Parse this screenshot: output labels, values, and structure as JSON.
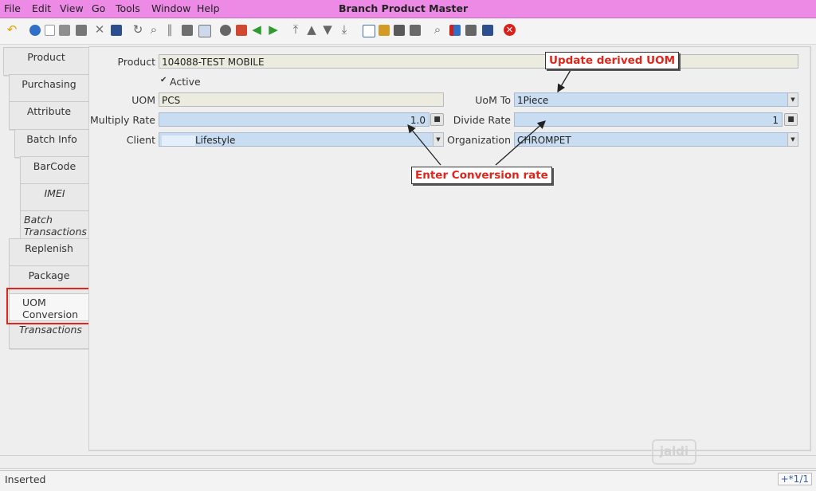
{
  "menu": {
    "file": "File",
    "edit": "Edit",
    "view": "View",
    "go": "Go",
    "tools": "Tools",
    "window": "Window",
    "help": "Help"
  },
  "window_title": "Branch Product Master",
  "tabs": [
    {
      "label": "Product"
    },
    {
      "label": "Purchasing"
    },
    {
      "label": "Attribute"
    },
    {
      "label": "Batch Info"
    },
    {
      "label": "BarCode"
    },
    {
      "label": "IMEI"
    },
    {
      "label": "Batch Transactions"
    },
    {
      "label": "Replenish"
    },
    {
      "label": "Package"
    },
    {
      "label": "UOM Conversion"
    },
    {
      "label": "Transactions"
    }
  ],
  "form": {
    "product_label": "Product",
    "product_value": "104088-TEST MOBILE",
    "active_label": "Active",
    "active_check": "✔",
    "uom_label": "UOM",
    "uom_value": "PCS",
    "uomto_label": "UoM To",
    "uomto_value": "1Piece",
    "multiply_label": "Multiply Rate",
    "multiply_value": "1.0",
    "divide_label": "Divide Rate",
    "divide_value": "1",
    "client_label": "Client",
    "client_value": "Lifestyle",
    "org_label": "Organization",
    "org_value": "CHROMPET"
  },
  "annotations": {
    "update_uom": "Update derived UOM",
    "enter_rate": "Enter Conversion rate"
  },
  "watermark": "jaldi",
  "status": {
    "text": "Inserted",
    "record": "+*1/1"
  },
  "colors": {
    "menubar": "#ec8ae6",
    "field_edit": "#c9ddf2",
    "field_readonly": "#ebebdf",
    "annotation": "#e0261c"
  },
  "toolbar_icons": [
    "undo-icon",
    "help-icon",
    "new-icon",
    "copy-icon",
    "delete-icon",
    "delete-selection-icon",
    "save-icon",
    "refresh-icon",
    "find-icon",
    "attachment-icon",
    "chat-icon",
    "grid-toggle-icon",
    "history-icon",
    "home-icon",
    "back-icon",
    "forward-icon",
    "first-record-icon",
    "previous-record-icon",
    "next-record-icon",
    "last-record-icon",
    "report-icon",
    "archive-icon",
    "print-preview-icon",
    "print-icon",
    "zoom-across-icon",
    "active-workflow-icon",
    "request-icon",
    "product-info-icon",
    "exit-icon"
  ]
}
